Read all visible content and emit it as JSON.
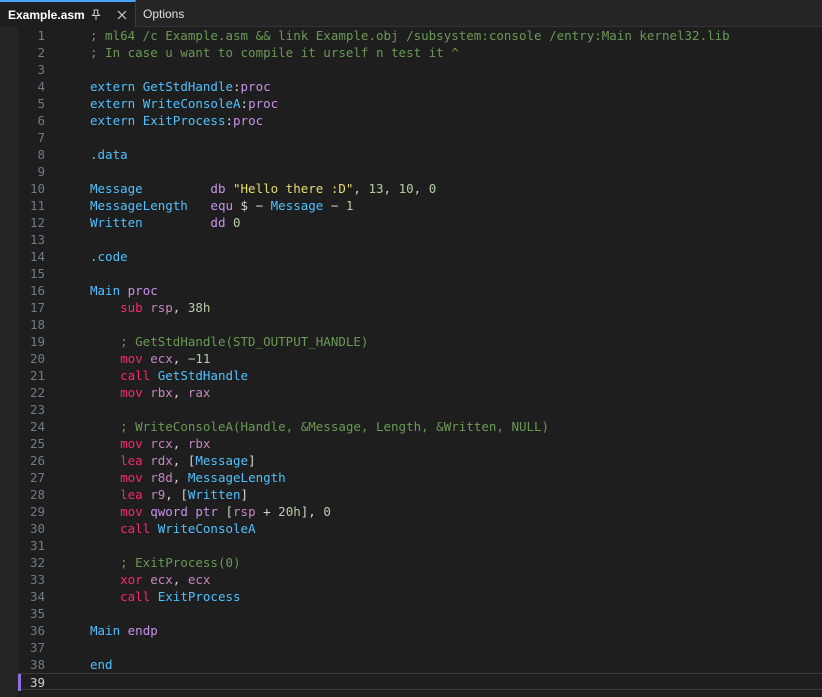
{
  "tabs": {
    "active": {
      "title": "Example.asm",
      "pin_icon": "pin-icon",
      "close_icon": "close-icon"
    },
    "secondary": {
      "title": "Options"
    }
  },
  "editor": {
    "current_line": 39,
    "lines": [
      {
        "n": "1",
        "tokens": [
          [
            "comment",
            "; ml64 /c Example.asm && link Example.obj /subsystem:console /entry:Main kernel32.lib"
          ]
        ]
      },
      {
        "n": "2",
        "tokens": [
          [
            "comment",
            "; In case u want to compile it urself n test it ^"
          ]
        ]
      },
      {
        "n": "3",
        "tokens": []
      },
      {
        "n": "4",
        "tokens": [
          [
            "sym",
            "extern "
          ],
          [
            "sym",
            "GetStdHandle"
          ],
          [
            "op",
            ":"
          ],
          [
            "kw",
            "proc"
          ]
        ]
      },
      {
        "n": "5",
        "tokens": [
          [
            "sym",
            "extern "
          ],
          [
            "sym",
            "WriteConsoleA"
          ],
          [
            "op",
            ":"
          ],
          [
            "kw",
            "proc"
          ]
        ]
      },
      {
        "n": "6",
        "tokens": [
          [
            "sym",
            "extern "
          ],
          [
            "sym",
            "ExitProcess"
          ],
          [
            "op",
            ":"
          ],
          [
            "kw",
            "proc"
          ]
        ]
      },
      {
        "n": "7",
        "tokens": []
      },
      {
        "n": "8",
        "tokens": [
          [
            "sym",
            ".data"
          ]
        ]
      },
      {
        "n": "9",
        "tokens": []
      },
      {
        "n": "10",
        "tokens": [
          [
            "sym",
            "Message         "
          ],
          [
            "kw",
            "db "
          ],
          [
            "str",
            "\"Hello there :D\""
          ],
          [
            "op",
            ", "
          ],
          [
            "num",
            "13"
          ],
          [
            "op",
            ", "
          ],
          [
            "num",
            "10"
          ],
          [
            "op",
            ", "
          ],
          [
            "num",
            "0"
          ]
        ]
      },
      {
        "n": "11",
        "tokens": [
          [
            "sym",
            "MessageLength   "
          ],
          [
            "kw",
            "equ "
          ],
          [
            "op",
            "$ − "
          ],
          [
            "sym",
            "Message"
          ],
          [
            "op",
            " − "
          ],
          [
            "num",
            "1"
          ]
        ]
      },
      {
        "n": "12",
        "tokens": [
          [
            "sym",
            "Written         "
          ],
          [
            "kw",
            "dd "
          ],
          [
            "num",
            "0"
          ]
        ]
      },
      {
        "n": "13",
        "tokens": []
      },
      {
        "n": "14",
        "tokens": [
          [
            "sym",
            ".code"
          ]
        ]
      },
      {
        "n": "15",
        "tokens": []
      },
      {
        "n": "16",
        "tokens": [
          [
            "sym",
            "Main "
          ],
          [
            "kw",
            "proc"
          ]
        ]
      },
      {
        "n": "17",
        "tokens": [
          [
            "op",
            "    "
          ],
          [
            "ins",
            "sub "
          ],
          [
            "reg",
            "rsp"
          ],
          [
            "op",
            ", "
          ],
          [
            "num",
            "38h"
          ]
        ]
      },
      {
        "n": "18",
        "tokens": []
      },
      {
        "n": "19",
        "tokens": [
          [
            "op",
            "    "
          ],
          [
            "comment",
            "; GetStdHandle(STD_OUTPUT_HANDLE)"
          ]
        ]
      },
      {
        "n": "20",
        "tokens": [
          [
            "op",
            "    "
          ],
          [
            "ins",
            "mov "
          ],
          [
            "reg",
            "ecx"
          ],
          [
            "op",
            ", "
          ],
          [
            "num",
            "−11"
          ]
        ]
      },
      {
        "n": "21",
        "tokens": [
          [
            "op",
            "    "
          ],
          [
            "ins",
            "call "
          ],
          [
            "sym",
            "GetStdHandle"
          ]
        ]
      },
      {
        "n": "22",
        "tokens": [
          [
            "op",
            "    "
          ],
          [
            "ins",
            "mov "
          ],
          [
            "reg",
            "rbx"
          ],
          [
            "op",
            ", "
          ],
          [
            "reg",
            "rax"
          ]
        ]
      },
      {
        "n": "23",
        "tokens": []
      },
      {
        "n": "24",
        "tokens": [
          [
            "op",
            "    "
          ],
          [
            "comment",
            "; WriteConsoleA(Handle, &Message, Length, &Written, NULL)"
          ]
        ]
      },
      {
        "n": "25",
        "tokens": [
          [
            "op",
            "    "
          ],
          [
            "ins",
            "mov "
          ],
          [
            "reg",
            "rcx"
          ],
          [
            "op",
            ", "
          ],
          [
            "reg",
            "rbx"
          ]
        ]
      },
      {
        "n": "26",
        "tokens": [
          [
            "op",
            "    "
          ],
          [
            "ins",
            "lea "
          ],
          [
            "reg",
            "rdx"
          ],
          [
            "op",
            ", ["
          ],
          [
            "sym",
            "Message"
          ],
          [
            "op",
            "]"
          ]
        ]
      },
      {
        "n": "27",
        "tokens": [
          [
            "op",
            "    "
          ],
          [
            "ins",
            "mov "
          ],
          [
            "reg",
            "r8d"
          ],
          [
            "op",
            ", "
          ],
          [
            "sym",
            "MessageLength"
          ]
        ]
      },
      {
        "n": "28",
        "tokens": [
          [
            "op",
            "    "
          ],
          [
            "ins",
            "lea "
          ],
          [
            "reg",
            "r9"
          ],
          [
            "op",
            ", ["
          ],
          [
            "sym",
            "Written"
          ],
          [
            "op",
            "]"
          ]
        ]
      },
      {
        "n": "29",
        "tokens": [
          [
            "op",
            "    "
          ],
          [
            "ins",
            "mov "
          ],
          [
            "kw",
            "qword ptr "
          ],
          [
            "op",
            "["
          ],
          [
            "reg",
            "rsp"
          ],
          [
            "op",
            " + "
          ],
          [
            "num",
            "20h"
          ],
          [
            "op",
            "], "
          ],
          [
            "num",
            "0"
          ]
        ]
      },
      {
        "n": "30",
        "tokens": [
          [
            "op",
            "    "
          ],
          [
            "ins",
            "call "
          ],
          [
            "sym",
            "WriteConsoleA"
          ]
        ]
      },
      {
        "n": "31",
        "tokens": []
      },
      {
        "n": "32",
        "tokens": [
          [
            "op",
            "    "
          ],
          [
            "comment",
            "; ExitProcess(0)"
          ]
        ]
      },
      {
        "n": "33",
        "tokens": [
          [
            "op",
            "    "
          ],
          [
            "ins",
            "xor "
          ],
          [
            "reg",
            "ecx"
          ],
          [
            "op",
            ", "
          ],
          [
            "reg",
            "ecx"
          ]
        ]
      },
      {
        "n": "34",
        "tokens": [
          [
            "op",
            "    "
          ],
          [
            "ins",
            "call "
          ],
          [
            "sym",
            "ExitProcess"
          ]
        ]
      },
      {
        "n": "35",
        "tokens": []
      },
      {
        "n": "36",
        "tokens": [
          [
            "sym",
            "Main "
          ],
          [
            "kw",
            "endp"
          ]
        ]
      },
      {
        "n": "37",
        "tokens": []
      },
      {
        "n": "38",
        "tokens": [
          [
            "sym",
            "end"
          ]
        ]
      },
      {
        "n": "39",
        "tokens": []
      }
    ]
  },
  "colors": {
    "background": "#1e1e1e",
    "accent": "#4aa3ff",
    "current_line_marker": "#8f6ee0",
    "comment": "#6a9955",
    "keyword": "#c792ea",
    "instruction": "#f92672",
    "symbol": "#4fc1ff",
    "register": "#c586c0",
    "number": "#b5cea8",
    "string": "#e6db74"
  }
}
